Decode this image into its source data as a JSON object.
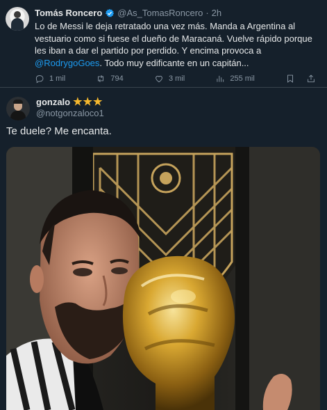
{
  "quoted": {
    "name": "Tomás Roncero",
    "handle": "@As_TomasRoncero",
    "separator": "·",
    "time": "2h",
    "text_parts": {
      "before_mention": "Lo de Messi le deja retratado una vez más. Manda a Argentina al vestuario como si fuese el dueño de Maracaná. Vuelve rápido porque les iban a dar el partido por perdido. Y encima provoca a ",
      "mention": "@RodrygoGoes",
      "after_mention": ". Todo muy edificante en un capitán..."
    },
    "actions": {
      "replies": "1 mil",
      "retweets": "794",
      "likes": "3 mil",
      "views": "255 mil"
    }
  },
  "reply": {
    "name": "gonzalo",
    "stars": "★★★",
    "handle": "@notgonzaloco1",
    "text": "Te duele? Me encanta."
  },
  "colors": {
    "background": "#15202b",
    "text": "#e7e9ea",
    "muted": "#8b98a5",
    "link": "#1d9bf0",
    "verified": "#1d9bf0",
    "stars": "#f5b82e"
  }
}
